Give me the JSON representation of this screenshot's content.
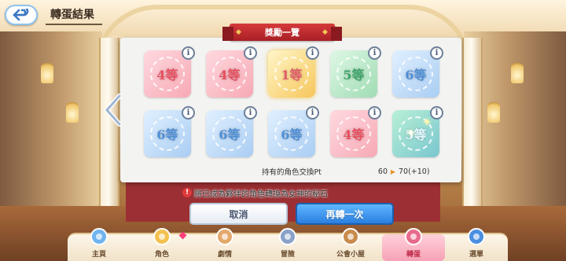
{
  "header": {
    "title": "轉蛋結果"
  },
  "panel": {
    "ribbon_title": "獎勵一覽",
    "rewards": [
      {
        "rank": "4等",
        "style": "pink"
      },
      {
        "rank": "4等",
        "style": "pink"
      },
      {
        "rank": "1等",
        "style": "gold"
      },
      {
        "rank": "5等",
        "style": "green"
      },
      {
        "rank": "6等",
        "style": "blue"
      },
      {
        "rank": "6等",
        "style": "blue"
      },
      {
        "rank": "6等",
        "style": "blue"
      },
      {
        "rank": "6等",
        "style": "blue"
      },
      {
        "rank": "4等",
        "style": "pink"
      },
      {
        "rank": "5等",
        "style": "greenblue"
      }
    ],
    "info_glyph": "i",
    "points": {
      "label": "持有的角色交換Pt",
      "current": "60",
      "new": "70(+10)"
    }
  },
  "notice": "將已成為夥伴的角色轉換為女神的秘石",
  "buttons": {
    "cancel": "取消",
    "retry": "再轉一次"
  },
  "bottom_nav": [
    {
      "label": "主頁",
      "active": false,
      "badge": false,
      "color": "#6fb4ef"
    },
    {
      "label": "角色",
      "active": false,
      "badge": true,
      "color": "#f3c14e"
    },
    {
      "label": "劇情",
      "active": false,
      "badge": false,
      "color": "#e3a86b"
    },
    {
      "label": "冒險",
      "active": false,
      "badge": false,
      "color": "#8aa2c8"
    },
    {
      "label": "公會小屋",
      "active": false,
      "badge": false,
      "color": "#c98a4a"
    },
    {
      "label": "轉蛋",
      "active": true,
      "badge": false,
      "color": "#e86a8b"
    },
    {
      "label": "選單",
      "active": false,
      "badge": false,
      "color": "#4a8fe0"
    }
  ],
  "colors": {
    "accent_red": "#c22a2f",
    "retry_blue": "#2a7fe0",
    "active_tab": "#f6a2b6"
  }
}
